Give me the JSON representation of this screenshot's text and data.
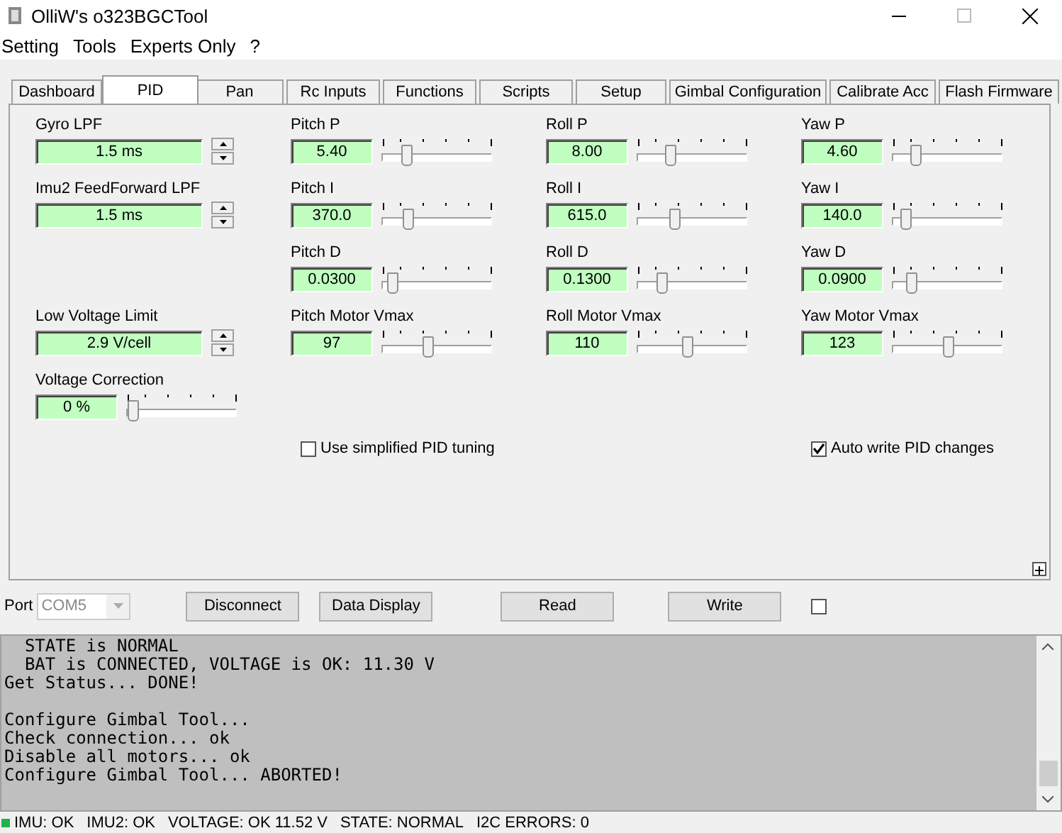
{
  "window": {
    "title": "OlliW's o323BGCTool"
  },
  "menu": [
    "Setting",
    "Tools",
    "Experts Only",
    "?"
  ],
  "tabs": [
    {
      "label": "Dashboard",
      "selected": false
    },
    {
      "label": "PID",
      "selected": true
    },
    {
      "label": "Pan",
      "selected": false
    },
    {
      "label": "Rc Inputs",
      "selected": false
    },
    {
      "label": "Functions",
      "selected": false
    },
    {
      "label": "Scripts",
      "selected": false
    },
    {
      "label": "Setup",
      "selected": false
    },
    {
      "label": "Gimbal Configuration",
      "selected": false
    },
    {
      "label": "Calibrate Acc",
      "selected": false
    },
    {
      "label": "Flash Firmware",
      "selected": false
    }
  ],
  "columns": [
    {
      "items": [
        {
          "kind": "spin",
          "label": "Gyro LPF",
          "value": "1.5 ms"
        },
        {
          "kind": "spin",
          "label": "Imu2 FeedForward LPF",
          "value": "1.5 ms"
        },
        {
          "kind": "spin",
          "label": "Low Voltage Limit",
          "value": "2.9 V/cell"
        },
        {
          "kind": "slider",
          "label": "Voltage Correction",
          "value": "0 %",
          "level": 0.02
        }
      ]
    },
    {
      "items": [
        {
          "kind": "slider",
          "label": "Pitch P",
          "value": "5.40",
          "level": 0.2
        },
        {
          "kind": "slider",
          "label": "Pitch I",
          "value": "370.0",
          "level": 0.21
        },
        {
          "kind": "slider",
          "label": "Pitch D",
          "value": "0.0300",
          "level": 0.06
        },
        {
          "kind": "slider",
          "label": "Pitch Motor Vmax",
          "value": "97",
          "level": 0.4
        }
      ]
    },
    {
      "items": [
        {
          "kind": "slider",
          "label": "Roll P",
          "value": "8.00",
          "level": 0.28
        },
        {
          "kind": "slider",
          "label": "Roll I",
          "value": "615.0",
          "level": 0.32
        },
        {
          "kind": "slider",
          "label": "Roll D",
          "value": "0.1300",
          "level": 0.2
        },
        {
          "kind": "slider",
          "label": "Roll Motor Vmax",
          "value": "110",
          "level": 0.45
        }
      ]
    },
    {
      "items": [
        {
          "kind": "slider",
          "label": "Yaw P",
          "value": "4.60",
          "level": 0.18
        },
        {
          "kind": "slider",
          "label": "Yaw I",
          "value": "140.0",
          "level": 0.08
        },
        {
          "kind": "slider",
          "label": "Yaw D",
          "value": "0.0900",
          "level": 0.14
        },
        {
          "kind": "slider",
          "label": "Yaw Motor Vmax",
          "value": "123",
          "level": 0.5
        }
      ]
    }
  ],
  "options": [
    {
      "label": "Use simplified PID tuning",
      "checked": false
    },
    {
      "label": "Auto write PID changes",
      "checked": true
    }
  ],
  "port": {
    "label": "Port",
    "value": "COM5",
    "disabled": true
  },
  "buttons": [
    "Disconnect",
    "Data Display",
    "Read",
    "Write"
  ],
  "extra_checkbox": {
    "checked": false
  },
  "log": [
    [
      "  STATE is NORMAL",
      "  BAT is CONNECTED, VOLTAGE is OK: 11.30 V",
      "Get Status... DONE!"
    ],
    [
      "Configure Gimbal Tool...",
      "Check connection... ok",
      "Disable all motors... ok",
      "Configure Gimbal Tool... ABORTED!"
    ]
  ],
  "status_bar": {
    "color": "#22b14c",
    "items": [
      "IMU: OK",
      "IMU2: OK",
      "VOLTAGE: OK 11.52 V",
      "STATE: NORMAL",
      "I2C ERRORS: 0"
    ]
  }
}
